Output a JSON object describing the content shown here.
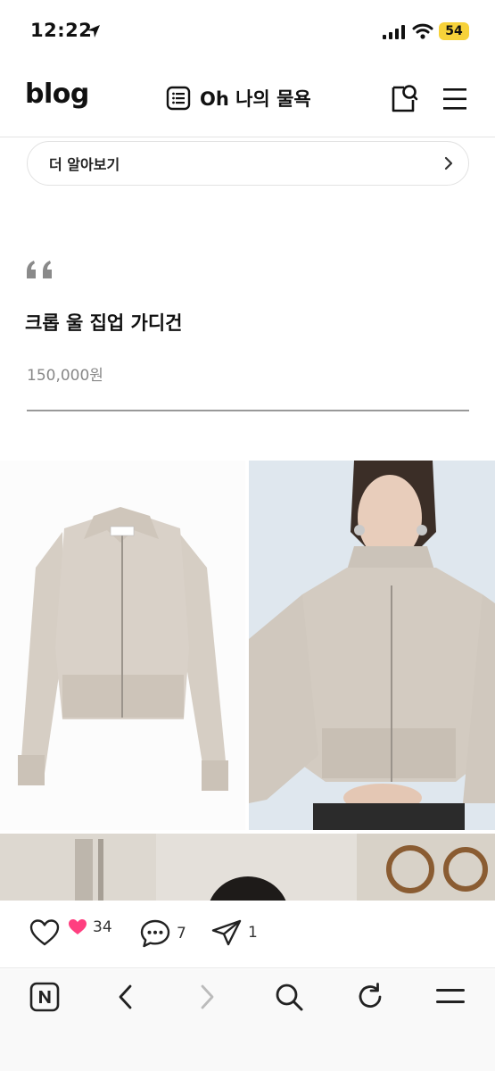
{
  "status_bar": {
    "time": "12:22",
    "battery": "54"
  },
  "header": {
    "logo": "blog",
    "title": "Oh 나의 물욕"
  },
  "learn_more": {
    "label": "더 알아보기"
  },
  "product": {
    "name": "크롭 울 집업 가디건",
    "price": "150,000원"
  },
  "reactions": {
    "likes": "34",
    "comments": "7",
    "shares": "1"
  },
  "colors": {
    "heart": "#ff3f80",
    "battery": "#f7d23a",
    "sweater": "#d8d0c6"
  },
  "icons": [
    "location-arrow-icon",
    "signal-icon",
    "wifi-icon",
    "list-icon",
    "search-tag-icon",
    "menu-icon",
    "chevron-right-icon",
    "quote-icon",
    "heart-outline-icon",
    "heart-filled-icon",
    "comment-icon",
    "share-icon",
    "naver-home-icon",
    "back-icon",
    "forward-icon",
    "search-icon",
    "refresh-icon"
  ]
}
